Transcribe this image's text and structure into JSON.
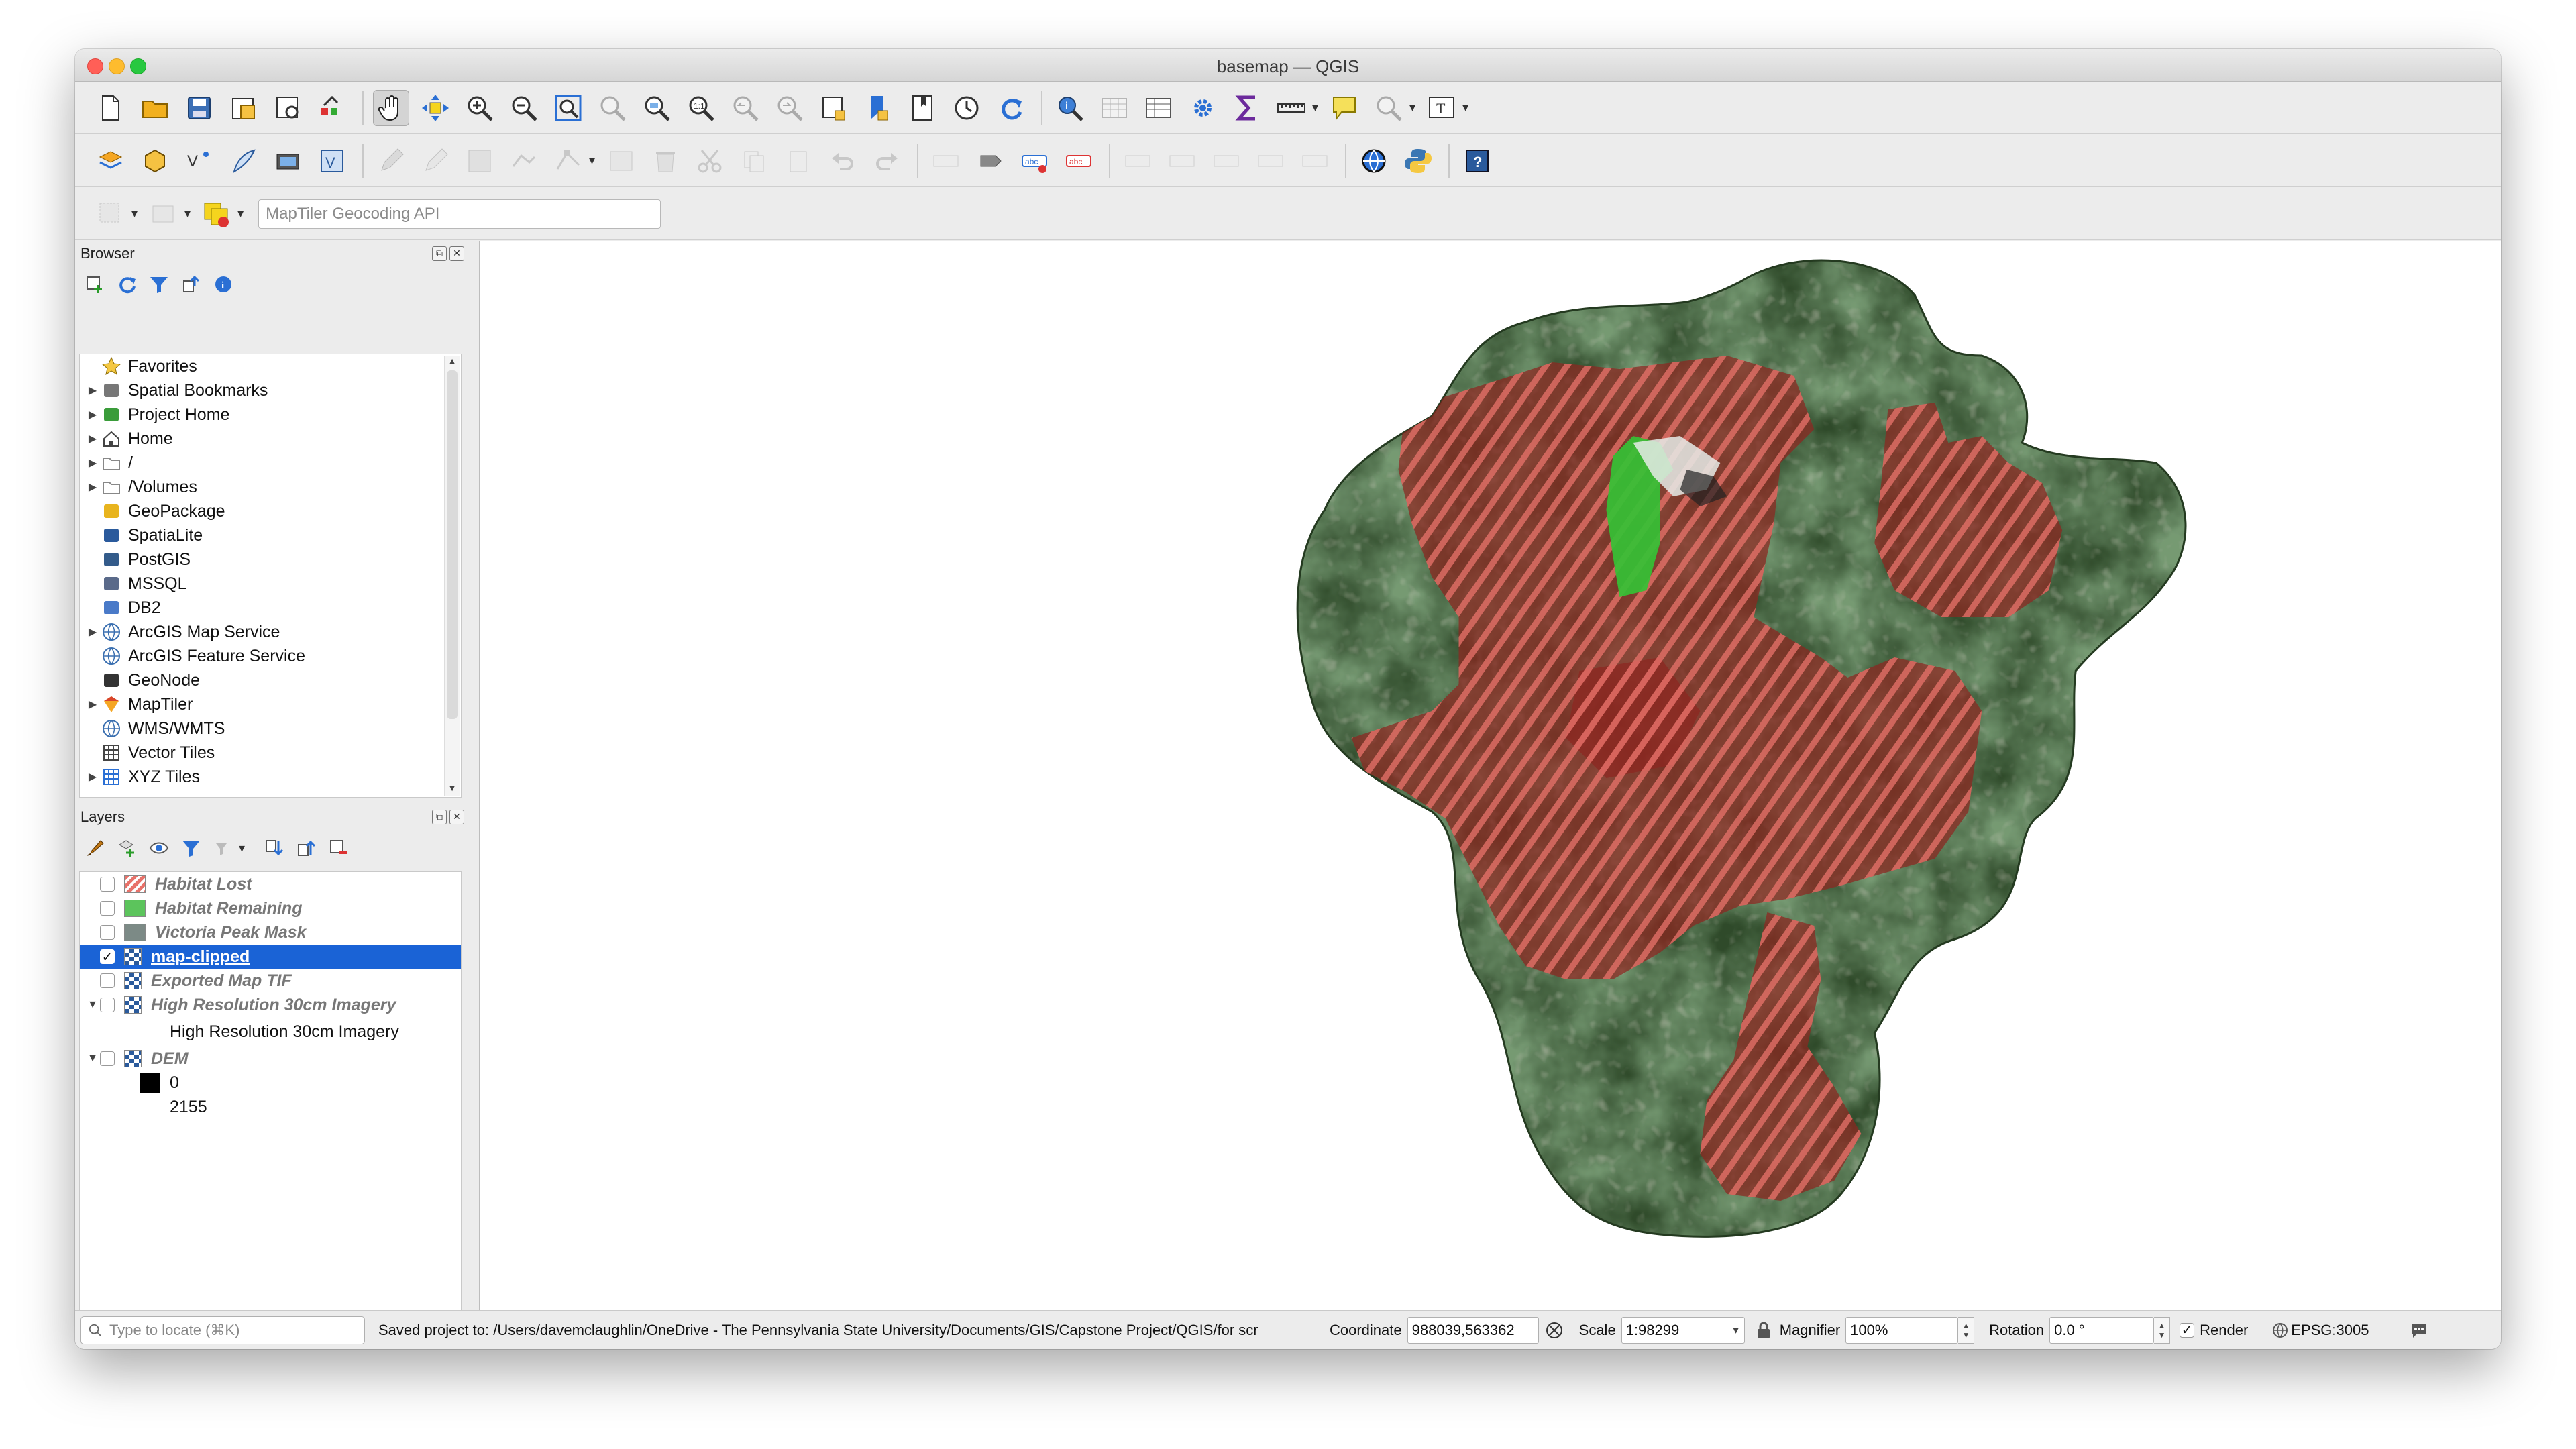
{
  "window": {
    "title": "basemap — QGIS"
  },
  "toolbar3": {
    "geocoder_placeholder": "MapTiler Geocoding API"
  },
  "browser": {
    "title": "Browser",
    "items": [
      {
        "label": "Favorites",
        "icon": "star-icon",
        "expandable": false
      },
      {
        "label": "Spatial Bookmarks",
        "icon": "bookmark-icon",
        "expandable": true
      },
      {
        "label": "Project Home",
        "icon": "project-home-icon",
        "expandable": true
      },
      {
        "label": "Home",
        "icon": "home-icon",
        "expandable": true
      },
      {
        "label": "/",
        "icon": "folder-icon",
        "expandable": true
      },
      {
        "label": "/Volumes",
        "icon": "folder-icon",
        "expandable": true
      },
      {
        "label": "GeoPackage",
        "icon": "geopackage-icon",
        "expandable": false
      },
      {
        "label": "SpatiaLite",
        "icon": "spatialite-icon",
        "expandable": false
      },
      {
        "label": "PostGIS",
        "icon": "postgis-icon",
        "expandable": false
      },
      {
        "label": "MSSQL",
        "icon": "mssql-icon",
        "expandable": false
      },
      {
        "label": "DB2",
        "icon": "db2-icon",
        "expandable": false
      },
      {
        "label": "ArcGIS Map Service",
        "icon": "globe-icon",
        "expandable": true
      },
      {
        "label": "ArcGIS Feature Service",
        "icon": "globe-icon",
        "expandable": false
      },
      {
        "label": "GeoNode",
        "icon": "geonode-icon",
        "expandable": false
      },
      {
        "label": "MapTiler",
        "icon": "maptiler-icon",
        "expandable": true
      },
      {
        "label": "WMS/WMTS",
        "icon": "globe-icon",
        "expandable": false
      },
      {
        "label": "Vector Tiles",
        "icon": "grid-icon",
        "expandable": false
      },
      {
        "label": "XYZ Tiles",
        "icon": "tiles-icon",
        "expandable": true
      }
    ]
  },
  "layers": {
    "title": "Layers",
    "items": [
      {
        "name": "Habitat Lost",
        "checked": false,
        "swatch": "hatch-red"
      },
      {
        "name": "Habitat Remaining",
        "checked": false,
        "swatch": "#5cc45c"
      },
      {
        "name": "Victoria Peak Mask",
        "checked": false,
        "swatch": "#7c8a86"
      },
      {
        "name": "map-clipped",
        "checked": true,
        "swatch": "raster",
        "selected": true
      },
      {
        "name": "Exported Map TIF",
        "checked": false,
        "swatch": "raster"
      },
      {
        "name": "High Resolution 30cm Imagery",
        "checked": false,
        "swatch": "raster",
        "expanded": true,
        "sublabel": "High Resolution 30cm Imagery"
      },
      {
        "name": "DEM",
        "checked": false,
        "swatch": "raster",
        "expanded": true,
        "legend": [
          "0",
          "2155"
        ]
      }
    ]
  },
  "status": {
    "locate_placeholder": "Type to locate (⌘K)",
    "message": "Saved project to: /Users/davemclaughlin/OneDrive - The Pennsylvania State University/Documents/GIS/Capstone Project/QGIS/for scr",
    "coordinate_label": "Coordinate",
    "coordinate": "988039,563362",
    "scale_label": "Scale",
    "scale": "1:98299",
    "magnifier_label": "Magnifier",
    "magnifier": "100%",
    "rotation_label": "Rotation",
    "rotation": "0.0 °",
    "render_label": "Render",
    "crs": "EPSG:3005"
  },
  "colors": {
    "selection": "#1a63d6",
    "habitat_lost": "#b3312a",
    "habitat_remaining": "#35c135",
    "forest": "#3c5a30"
  }
}
